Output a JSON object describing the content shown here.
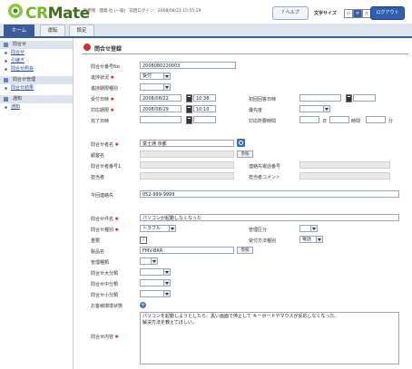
{
  "header": {
    "logo_text_1": "CR",
    "logo_text_2": "Mate",
    "info_1": "利用者",
    "info_2": "開発 社 (一般)",
    "info_3": "前回ログイン：2008/08/22 15:55:29",
    "help": "ヘルプ",
    "font_size_label": "文字サイズ",
    "font_size_options": [
      "小",
      "中",
      "大"
    ],
    "logout": "ログアウト"
  },
  "tabs": [
    "ホーム",
    "運転",
    "設定"
  ],
  "sidebar": {
    "sections": [
      {
        "title": "問合せ",
        "items": [
          "問合せ",
          "引継ぎ",
          "問合せ照会"
        ]
      },
      {
        "title": "問合せ管理",
        "items": [
          "問合せ結果"
        ]
      },
      {
        "title": "通知",
        "items": [
          "通知"
        ]
      }
    ]
  },
  "form": {
    "title": "問合せ登録",
    "id_label": "問合せ番号No.",
    "id_value": "2008080220003",
    "status_label": "進捗状況",
    "status_value": "受付",
    "deadline_label": "進捗期限種別",
    "deadline_value": "",
    "received_label": "受付日時",
    "received_date": "2008/08/22",
    "received_time": "10:38",
    "first_reply_label": "初回回答日時",
    "first_reply_date": "",
    "first_reply_time": "",
    "response_label": "対応期限",
    "response_date": "2008/08/29",
    "response_time": "10:10",
    "priority_label": "優先度",
    "priority_value": "",
    "complete_label": "完了日時",
    "complete_date": "",
    "complete_time": "",
    "work_time_label": "対応所要時間",
    "work_day": "",
    "day_unit": "日",
    "work_hour": "",
    "hour_unit": "時間",
    "work_min": "",
    "min_unit": "分",
    "customer_label": "問合せ者名",
    "customer_value": "富士通 京都",
    "customer_name_label": "顧客名",
    "customer_name_value": "",
    "ref_btn": "参照",
    "cust_no_label": "問合せ者番号1",
    "cust_no_value": "",
    "contact_phone_label": "連絡先電話番号",
    "contact_phone_value": "",
    "person_label": "担当者",
    "person_value": "",
    "person_comment_label": "担当者コメント",
    "person_comment_value": "",
    "phone_label": "今回連絡先",
    "phone_value": "052-999-9999",
    "subject_label": "問合せ件名",
    "subject_value": "パソコンが起動しなくなった",
    "type_label": "問合せ種別",
    "type_value": "トラブル",
    "contact_type_label": "管理区分",
    "contact_type_value": "",
    "important_label": "重要",
    "important_checked": "✓",
    "method_label": "受付方法種別",
    "method_value": "電話",
    "product_label": "製品名",
    "product_value": "FMV-BRR",
    "ref_btn2": "参照",
    "mgmt_label": "管理種類",
    "mgmt_value": "",
    "cat1_label": "問合せ大分類",
    "cat1_value": "",
    "cat2_label": "問合せ中分類",
    "cat2_value": "",
    "cat3_label": "問合せ小分類",
    "cat3_value": "",
    "env_label": "お客様環境状態",
    "content_label": "問合せ内容",
    "content_value": "パソコンを起動しようとしたら、黒い画面で停止して キーボードやマウスが反応しなくなった。\n解決方法を教えてほしい。"
  }
}
